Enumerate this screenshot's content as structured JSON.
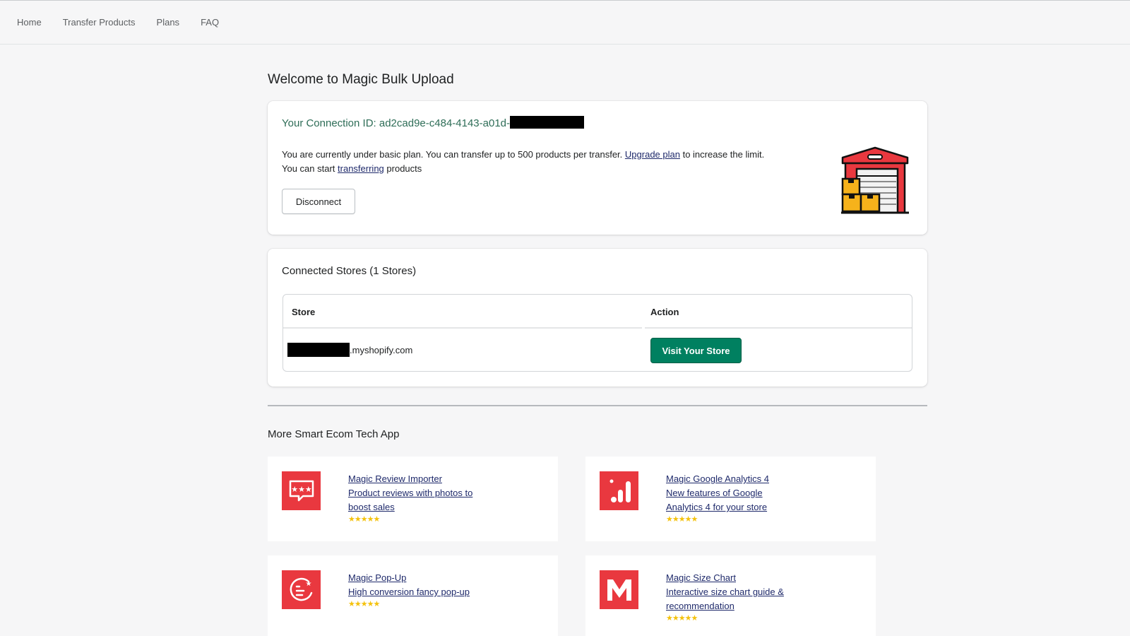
{
  "nav": {
    "items": [
      {
        "label": "Home"
      },
      {
        "label": "Transfer Products"
      },
      {
        "label": "Plans"
      },
      {
        "label": "FAQ"
      }
    ]
  },
  "page_title": "Welcome to Magic Bulk Upload",
  "connection": {
    "id_label": "Your Connection ID: ad2cad9e-c484-4143-a01d-",
    "plan_line1_pre": "You are currently under basic plan. You can transfer up to 500 products per transfer.",
    "plan_upgrade_link": "Upgrade plan",
    "plan_line1_post": "to increase the limit.",
    "plan_line2_pre": "You can start",
    "plan_transfer_link": "transferring",
    "plan_line2_post": "products",
    "disconnect_label": "Disconnect",
    "icon": "warehouse-icon"
  },
  "stores": {
    "title": "Connected Stores (1 Stores)",
    "columns": [
      "Store",
      "Action"
    ],
    "rows": [
      {
        "store_suffix": ".myshopify.com",
        "action_label": "Visit Your Store"
      }
    ]
  },
  "more_apps": {
    "title": "More Smart Ecom Tech App",
    "apps": [
      {
        "name": "Magic Review Importer",
        "desc": "Product reviews with photos to boost sales",
        "rating": "★★★★★",
        "icon": "review-chat-icon"
      },
      {
        "name": "Magic Google Analytics 4",
        "desc": "New features of Google Analytics 4 for your store",
        "rating": "★★★★★",
        "icon": "analytics-bars-icon"
      },
      {
        "name": "Magic Pop-Up",
        "desc": "High conversion fancy pop-up",
        "rating": "★★★★★",
        "icon": "popup-icon"
      },
      {
        "name": "Magic Size Chart",
        "desc": "Interactive size chart guide & recommendation",
        "rating": "★★★★★",
        "icon": "size-chart-m-icon"
      }
    ]
  },
  "colors": {
    "primary": "#008060",
    "connection_text": "#2e6d57",
    "app_red": "#e9383f",
    "star": "#f4c20d"
  }
}
